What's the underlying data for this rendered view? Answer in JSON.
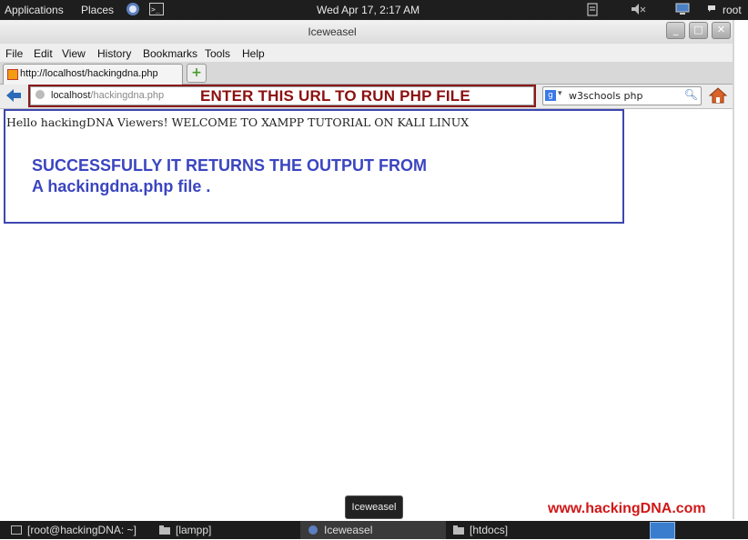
{
  "top_panel": {
    "applications": "Applications",
    "places": "Places",
    "clock": "Wed Apr 17,  2:17 AM",
    "user": "root"
  },
  "window": {
    "title": "Iceweasel",
    "controls": [
      "_",
      "□",
      "✕"
    ]
  },
  "menu": {
    "items": [
      "File",
      "Edit",
      "View",
      "History",
      "Bookmarks",
      "Tools",
      "Help"
    ]
  },
  "tabs": {
    "active_tab": "http://localhost/hackingdna.php",
    "new_tab": "+"
  },
  "navigation": {
    "url_host": "localhost",
    "url_path": "/hackingdna.php",
    "annotation": "ENTER THIS URL TO RUN PHP FILE",
    "search_query": "w3schools php",
    "search_engine": "g"
  },
  "content": {
    "hello_text": "Hello hackingDNA Viewers! WELCOME TO XAMPP TUTORIAL ON KALI LINUX",
    "note_line1": "SUCCESSFULLY IT RETURNS THE OUTPUT FROM",
    "note_line2": "A hackingdna.php file ."
  },
  "tooltip": "Iceweasel",
  "watermark": "www.hackingDNA.com",
  "taskbar": {
    "items": [
      "[root@hackingDNA: ~]",
      "[lampp]",
      "Iceweasel",
      "[htdocs]"
    ]
  },
  "colors": {
    "annotation": "#8b1010",
    "note": "#3b45c0",
    "highlight_border": "#3d47b0",
    "watermark": "#d01818"
  }
}
